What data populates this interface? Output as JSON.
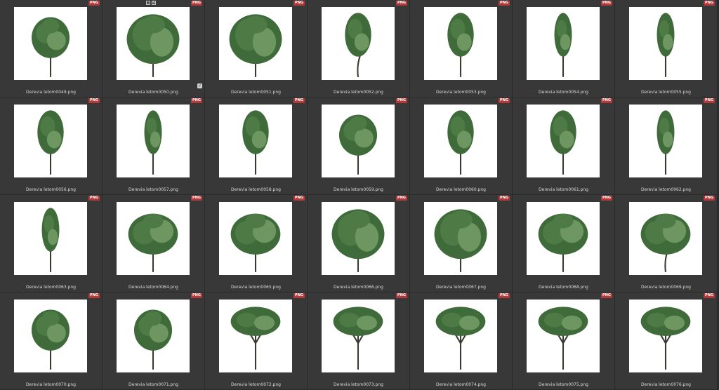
{
  "badge_label": "PNG",
  "colors": {
    "background": "#2b2b2b",
    "cell": "#383838",
    "badge": "#b33a3a",
    "canopy": "#4e7a45"
  },
  "tiles": [
    {
      "file": "Derevia letom0049.png",
      "shape": "round",
      "trunk": "straight"
    },
    {
      "file": "Derevia letom0050.png",
      "shape": "droopy",
      "trunk": "split",
      "selected": true
    },
    {
      "file": "Derevia letom0051.png",
      "shape": "droopy",
      "trunk": "split"
    },
    {
      "file": "Derevia letom0052.png",
      "shape": "tall",
      "trunk": "curved"
    },
    {
      "file": "Derevia letom0053.png",
      "shape": "tall",
      "trunk": "straight"
    },
    {
      "file": "Derevia letom0054.png",
      "shape": "slim",
      "trunk": "straight"
    },
    {
      "file": "Derevia letom0055.png",
      "shape": "slim",
      "trunk": "straight"
    },
    {
      "file": "Derevia letom0056.png",
      "shape": "tall",
      "trunk": "straight"
    },
    {
      "file": "Derevia letom0057.png",
      "shape": "slim",
      "trunk": "straight"
    },
    {
      "file": "Derevia letom0058.png",
      "shape": "tall",
      "trunk": "straight"
    },
    {
      "file": "Derevia letom0059.png",
      "shape": "round",
      "trunk": "straight"
    },
    {
      "file": "Derevia letom0060.png",
      "shape": "tall",
      "trunk": "straight"
    },
    {
      "file": "Derevia letom0061.png",
      "shape": "tall",
      "trunk": "straight"
    },
    {
      "file": "Derevia letom0062.png",
      "shape": "slim",
      "trunk": "straight"
    },
    {
      "file": "Derevia letom0063.png",
      "shape": "slim",
      "trunk": "straight"
    },
    {
      "file": "Derevia letom0064.png",
      "shape": "wide",
      "trunk": "straight"
    },
    {
      "file": "Derevia letom0065.png",
      "shape": "wide",
      "trunk": "straight"
    },
    {
      "file": "Derevia letom0066.png",
      "shape": "droopy",
      "trunk": "straight"
    },
    {
      "file": "Derevia letom0067.png",
      "shape": "droopy",
      "trunk": "straight"
    },
    {
      "file": "Derevia letom0068.png",
      "shape": "wide",
      "trunk": "straight"
    },
    {
      "file": "Derevia letom0069.png",
      "shape": "wide",
      "trunk": "curved"
    },
    {
      "file": "Derevia letom0070.png",
      "shape": "round",
      "trunk": "straight"
    },
    {
      "file": "Derevia letom0071.png",
      "shape": "round",
      "trunk": "straight"
    },
    {
      "file": "Derevia letom0072.png",
      "shape": "umbrella",
      "trunk": "straight"
    },
    {
      "file": "Derevia letom0073.png",
      "shape": "umbrella",
      "trunk": "split"
    },
    {
      "file": "Derevia letom0074.png",
      "shape": "umbrella",
      "trunk": "straight"
    },
    {
      "file": "Derevia letom0075.png",
      "shape": "umbrella",
      "trunk": "straight"
    },
    {
      "file": "Derevia letom0076.png",
      "shape": "umbrella",
      "trunk": "straight"
    }
  ]
}
